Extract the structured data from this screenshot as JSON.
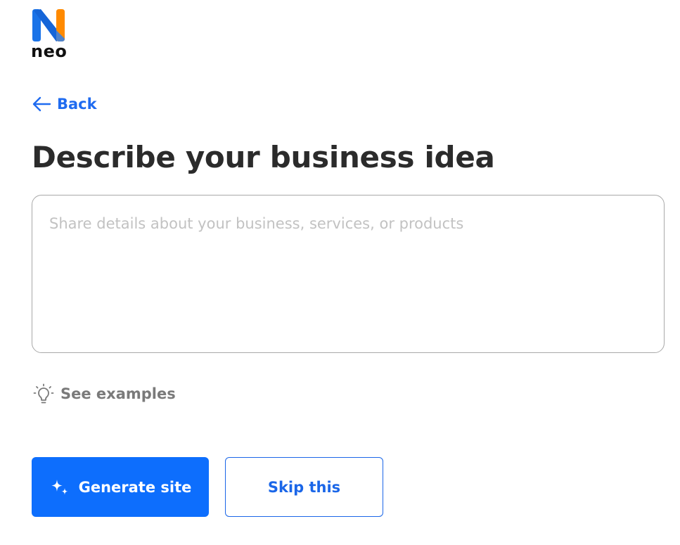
{
  "brand": {
    "name": "neo",
    "colors": {
      "blue": "#1a73e8",
      "orange": "#ff8a00"
    }
  },
  "nav": {
    "back_label": "Back",
    "back_icon": "arrow-left-icon"
  },
  "main": {
    "title": "Describe your business idea",
    "idea_input": {
      "value": "",
      "placeholder": "Share details about your business, services, or products"
    },
    "examples": {
      "icon": "lightbulb-icon",
      "label": "See examples"
    }
  },
  "actions": {
    "generate": {
      "icon": "sparkles-icon",
      "label": "Generate site"
    },
    "skip": {
      "label": "Skip this"
    }
  },
  "colors": {
    "accent": "#0d6efd",
    "text_dark": "#2b2b2b",
    "text_muted": "#7a7a7a",
    "border": "#a8a8a8"
  }
}
